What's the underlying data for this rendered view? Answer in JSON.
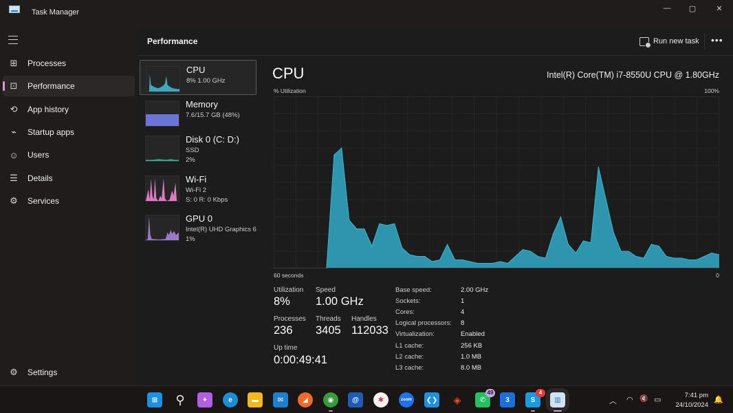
{
  "window": {
    "title": "Task Manager",
    "minimize_glyph": "—",
    "maximize_glyph": "▢",
    "close_glyph": "✕"
  },
  "nav": {
    "items": [
      {
        "label": "Processes",
        "icon": "processes-icon",
        "glyph": "⊞"
      },
      {
        "label": "Performance",
        "icon": "performance-icon",
        "glyph": "⊡",
        "active": true
      },
      {
        "label": "App history",
        "icon": "history-icon",
        "glyph": "⟲"
      },
      {
        "label": "Startup apps",
        "icon": "startup-icon",
        "glyph": "⌁"
      },
      {
        "label": "Users",
        "icon": "users-icon",
        "glyph": "☺"
      },
      {
        "label": "Details",
        "icon": "details-icon",
        "glyph": "☰"
      },
      {
        "label": "Services",
        "icon": "services-icon",
        "glyph": "⚙"
      }
    ],
    "settings": {
      "label": "Settings",
      "glyph": "⚙"
    }
  },
  "header": {
    "title": "Performance",
    "run_new_task": "Run new task",
    "more": "•••"
  },
  "resources": [
    {
      "name": "CPU",
      "lines": [
        "8%  1.00 GHz"
      ],
      "color": "#3fa6c0",
      "selected": true
    },
    {
      "name": "Memory",
      "lines": [
        "7.6/15.7 GB (48%)"
      ],
      "color": "#6c74d4",
      "value_pct": 48
    },
    {
      "name": "Disk 0 (C: D:)",
      "lines": [
        "SSD",
        "2%"
      ],
      "color": "#2fa58a"
    },
    {
      "name": "Wi-Fi",
      "lines": [
        "Wi-Fi 2",
        "S: 0  R: 0 Kbps"
      ],
      "color": "#e07ac4"
    },
    {
      "name": "GPU 0",
      "lines": [
        "Intel(R) UHD Graphics 6",
        "1%"
      ],
      "color": "#9c79c8"
    }
  ],
  "cpu": {
    "title": "CPU",
    "model": "Intel(R) Core(TM) i7-8550U CPU @ 1.80GHz",
    "y_label": "% Utilization",
    "y_max_label": "100%",
    "x_left_label": "60 seconds",
    "x_right_label": "0",
    "fill_color": "#2f95ae",
    "line_color": "#3fb2cc"
  },
  "chart_data": {
    "type": "area",
    "title": "CPU",
    "xlabel": "60 seconds",
    "ylabel": "% Utilization",
    "ylim": [
      0,
      100
    ],
    "xlim": [
      60,
      0
    ],
    "grid": true,
    "values": [
      0,
      0,
      0,
      0,
      0,
      0,
      0,
      0,
      66,
      70,
      28,
      23,
      23,
      13,
      26,
      25,
      26,
      12,
      8,
      7,
      7,
      4,
      5,
      14,
      5,
      5,
      4,
      3,
      3,
      3,
      4,
      3,
      7,
      11,
      10,
      7,
      6,
      20,
      30,
      14,
      9,
      16,
      15,
      59,
      40,
      21,
      10,
      10,
      7,
      6,
      14,
      13,
      7,
      6,
      6,
      5,
      5,
      7,
      9,
      8
    ]
  },
  "stats": {
    "utilization": {
      "label": "Utilization",
      "value": "8%"
    },
    "speed": {
      "label": "Speed",
      "value": "1.00 GHz"
    },
    "processes": {
      "label": "Processes",
      "value": "236"
    },
    "threads": {
      "label": "Threads",
      "value": "3405"
    },
    "handles": {
      "label": "Handles",
      "value": "112033"
    },
    "uptime": {
      "label": "Up time",
      "value": "0:00:49:41"
    }
  },
  "specs": [
    {
      "key": "Base speed:",
      "value": "2.00 GHz"
    },
    {
      "key": "Sockets:",
      "value": "1"
    },
    {
      "key": "Cores:",
      "value": "4"
    },
    {
      "key": "Logical processors:",
      "value": "8"
    },
    {
      "key": "Virtualization:",
      "value": "Enabled"
    },
    {
      "key": "L1 cache:",
      "value": "256 KB"
    },
    {
      "key": "L2 cache:",
      "value": "1.0 MB"
    },
    {
      "key": "L3 cache:",
      "value": "8.0 MB"
    }
  ],
  "taskbar": {
    "apps": [
      {
        "name": "start",
        "glyph": "⊞",
        "bg": "#1e90e0"
      },
      {
        "name": "search",
        "glyph": "⚲",
        "bg": "transparent"
      },
      {
        "name": "copilot",
        "glyph": "✦",
        "bg": "#b060e0"
      },
      {
        "name": "edge",
        "glyph": "e",
        "bg": "#1a8fd6"
      },
      {
        "name": "file-explorer",
        "glyph": "▬",
        "bg": "#f2b81c"
      },
      {
        "name": "mail",
        "glyph": "✉",
        "bg": "#1d7fd0"
      },
      {
        "name": "postman",
        "glyph": "◢",
        "bg": "#f06a30"
      },
      {
        "name": "chrome",
        "glyph": "◉",
        "bg": "#3a9a40"
      },
      {
        "name": "app-m",
        "glyph": "@",
        "bg": "#1f5bb5"
      },
      {
        "name": "slack",
        "glyph": "✱",
        "bg": "#f2f2f2"
      },
      {
        "name": "zoom",
        "glyph": "zoom",
        "bg": "#1f6ff2"
      },
      {
        "name": "vscode",
        "glyph": "❮❯",
        "bg": "#1f8fe0"
      },
      {
        "name": "figma",
        "glyph": "◈",
        "bg": "transparent"
      },
      {
        "name": "whatsapp",
        "glyph": "✆",
        "bg": "#25c062",
        "badge": "49"
      },
      {
        "name": "app-3",
        "glyph": "3",
        "bg": "#1c6fdc"
      },
      {
        "name": "skype",
        "glyph": "S",
        "bg": "#1a9be0",
        "badge": "4"
      },
      {
        "name": "task-manager",
        "glyph": "▥",
        "bg": "#cfe3f2"
      }
    ],
    "tray": {
      "chevron": "︿",
      "wifi": "◠",
      "volume": "🔇",
      "battery": "▭",
      "time": "7:41 pm",
      "date": "24/10/2024",
      "notification": "🔔"
    }
  }
}
